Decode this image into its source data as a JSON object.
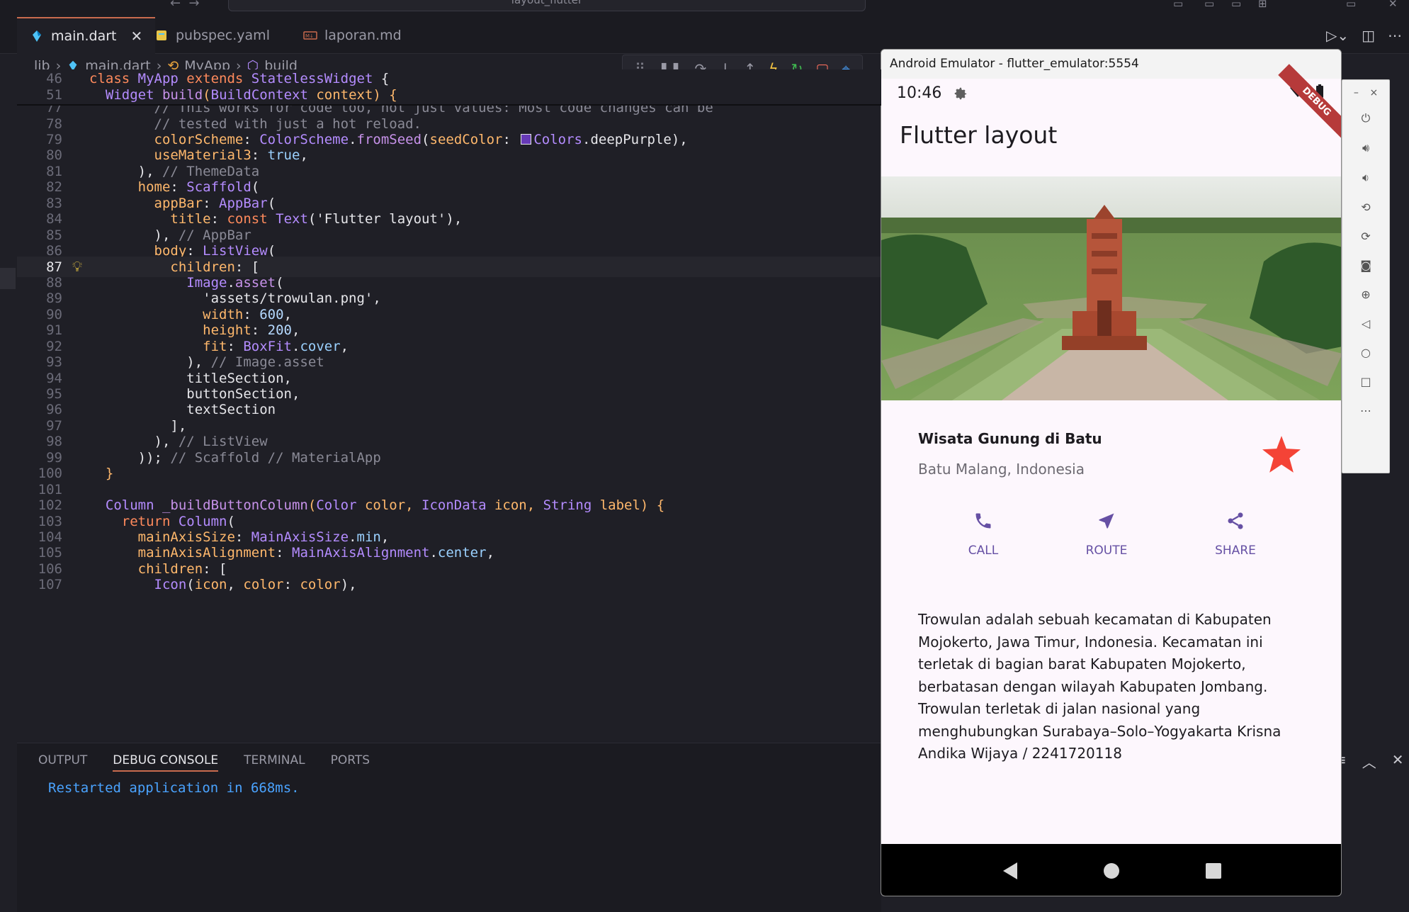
{
  "window": {
    "command_center": "layout_flutter"
  },
  "tabs": [
    {
      "label": "main.dart",
      "active": true
    },
    {
      "label": "pubspec.yaml",
      "active": false
    },
    {
      "label": "laporan.md",
      "active": false
    }
  ],
  "breadcrumb": [
    "lib",
    "main.dart",
    "MyApp",
    "build"
  ],
  "editor": {
    "sticky": [
      {
        "ln": "46",
        "tokens": [
          [
            "kw",
            "class "
          ],
          [
            "ty",
            "MyApp "
          ],
          [
            "kw",
            "extends "
          ],
          [
            "ty",
            "StatelessWidget "
          ],
          [
            "pl",
            "{"
          ]
        ]
      },
      {
        "ln": "51",
        "tokens": [
          [
            "pl",
            "  "
          ],
          [
            "ty",
            "Widget "
          ],
          [
            "fn",
            "build"
          ],
          [
            "prop",
            "("
          ],
          [
            "ty",
            "BuildContext "
          ],
          [
            "prop",
            "context"
          ],
          [
            "prop",
            ") {"
          ]
        ]
      }
    ],
    "lines": [
      {
        "ln": "77",
        "tokens": [
          [
            "cm",
            "        // This works for code too, not just values: Most code changes can be"
          ]
        ]
      },
      {
        "ln": "78",
        "tokens": [
          [
            "cm",
            "        // tested with just a hot reload."
          ]
        ]
      },
      {
        "ln": "79",
        "tokens": [
          [
            "prop",
            "        colorScheme"
          ],
          [
            "pl",
            ": "
          ],
          [
            "ty",
            "ColorScheme"
          ],
          [
            "pl",
            "."
          ],
          [
            "fn",
            "fromSeed"
          ],
          [
            "pl",
            "("
          ],
          [
            "prop",
            "seedColor"
          ],
          [
            "pl",
            ": "
          ],
          [
            "sw",
            ""
          ],
          [
            "ty",
            "Colors"
          ],
          [
            "pl",
            "."
          ],
          [
            "pl",
            "deepPurple"
          ],
          [
            "pl",
            "),"
          ]
        ]
      },
      {
        "ln": "80",
        "tokens": [
          [
            "prop",
            "        useMaterial3"
          ],
          [
            "pl",
            ": "
          ],
          [
            "lit",
            "true"
          ],
          [
            "pl",
            ","
          ]
        ]
      },
      {
        "ln": "81",
        "tokens": [
          [
            "pl",
            "      ), "
          ],
          [
            "cm",
            "// ThemeData"
          ]
        ]
      },
      {
        "ln": "82",
        "tokens": [
          [
            "prop",
            "      home"
          ],
          [
            "pl",
            ": "
          ],
          [
            "ty",
            "Scaffold"
          ],
          [
            "pl",
            "("
          ]
        ]
      },
      {
        "ln": "83",
        "tokens": [
          [
            "prop",
            "        appBar"
          ],
          [
            "pl",
            ": "
          ],
          [
            "ty",
            "AppBar"
          ],
          [
            "pl",
            "("
          ]
        ]
      },
      {
        "ln": "84",
        "tokens": [
          [
            "prop",
            "          title"
          ],
          [
            "pl",
            ": "
          ],
          [
            "kw",
            "const "
          ],
          [
            "ty",
            "Text"
          ],
          [
            "pl",
            "("
          ],
          [
            "str",
            "'Flutter layout'"
          ],
          [
            "pl",
            "),"
          ]
        ]
      },
      {
        "ln": "85",
        "tokens": [
          [
            "pl",
            "        ), "
          ],
          [
            "cm",
            "// AppBar"
          ]
        ]
      },
      {
        "ln": "86",
        "tokens": [
          [
            "prop",
            "        body"
          ],
          [
            "pl",
            ": "
          ],
          [
            "ty",
            "ListView"
          ],
          [
            "pl",
            "("
          ]
        ]
      },
      {
        "ln": "87",
        "tokens": [
          [
            "prop",
            "          children"
          ],
          [
            "pl",
            ": ["
          ]
        ]
      },
      {
        "ln": "88",
        "tokens": [
          [
            "ty",
            "            Image"
          ],
          [
            "pl",
            "."
          ],
          [
            "fn",
            "asset"
          ],
          [
            "pl",
            "("
          ]
        ]
      },
      {
        "ln": "89",
        "tokens": [
          [
            "str",
            "              'assets/trowulan.png'"
          ],
          [
            "pl",
            ","
          ]
        ]
      },
      {
        "ln": "90",
        "tokens": [
          [
            "prop",
            "              width"
          ],
          [
            "pl",
            ": "
          ],
          [
            "num",
            "600"
          ],
          [
            "pl",
            ","
          ]
        ]
      },
      {
        "ln": "91",
        "tokens": [
          [
            "prop",
            "              height"
          ],
          [
            "pl",
            ": "
          ],
          [
            "num",
            "200"
          ],
          [
            "pl",
            ","
          ]
        ]
      },
      {
        "ln": "92",
        "tokens": [
          [
            "prop",
            "              fit"
          ],
          [
            "pl",
            ": "
          ],
          [
            "ty",
            "BoxFit"
          ],
          [
            "pl",
            "."
          ],
          [
            "lit",
            "cover"
          ],
          [
            "pl",
            ","
          ]
        ]
      },
      {
        "ln": "93",
        "tokens": [
          [
            "pl",
            "            ), "
          ],
          [
            "cm",
            "// Image.asset"
          ]
        ]
      },
      {
        "ln": "94",
        "tokens": [
          [
            "pl",
            "            titleSection,"
          ]
        ]
      },
      {
        "ln": "95",
        "tokens": [
          [
            "pl",
            "            buttonSection,"
          ]
        ]
      },
      {
        "ln": "96",
        "tokens": [
          [
            "pl",
            "            textSection"
          ]
        ]
      },
      {
        "ln": "97",
        "tokens": [
          [
            "pl",
            "          ],"
          ]
        ]
      },
      {
        "ln": "98",
        "tokens": [
          [
            "pl",
            "        ), "
          ],
          [
            "cm",
            "// ListView"
          ]
        ]
      },
      {
        "ln": "99",
        "tokens": [
          [
            "pl",
            "      )); "
          ],
          [
            "cm",
            "// Scaffold // MaterialApp"
          ]
        ]
      },
      {
        "ln": "100",
        "tokens": [
          [
            "prop",
            "  }"
          ]
        ]
      },
      {
        "ln": "101",
        "tokens": [
          [
            "pl",
            ""
          ]
        ]
      },
      {
        "ln": "102",
        "tokens": [
          [
            "ty",
            "  Column "
          ],
          [
            "fn",
            "_buildButtonColumn"
          ],
          [
            "prop",
            "("
          ],
          [
            "ty",
            "Color "
          ],
          [
            "prop",
            "color, "
          ],
          [
            "ty",
            "IconData "
          ],
          [
            "prop",
            "icon, "
          ],
          [
            "ty",
            "String "
          ],
          [
            "prop",
            "label) {"
          ]
        ]
      },
      {
        "ln": "103",
        "tokens": [
          [
            "kw",
            "    return "
          ],
          [
            "ty",
            "Column"
          ],
          [
            "pl",
            "("
          ]
        ]
      },
      {
        "ln": "104",
        "tokens": [
          [
            "prop",
            "      mainAxisSize"
          ],
          [
            "pl",
            ": "
          ],
          [
            "ty",
            "MainAxisSize"
          ],
          [
            "pl",
            "."
          ],
          [
            "lit",
            "min"
          ],
          [
            "pl",
            ","
          ]
        ]
      },
      {
        "ln": "105",
        "tokens": [
          [
            "prop",
            "      mainAxisAlignment"
          ],
          [
            "pl",
            ": "
          ],
          [
            "ty",
            "MainAxisAlignment"
          ],
          [
            "pl",
            "."
          ],
          [
            "lit",
            "center"
          ],
          [
            "pl",
            ","
          ]
        ]
      },
      {
        "ln": "106",
        "tokens": [
          [
            "prop",
            "      children"
          ],
          [
            "pl",
            ": ["
          ]
        ]
      },
      {
        "ln": "107",
        "tokens": [
          [
            "ty",
            "        Icon"
          ],
          [
            "pl",
            "("
          ],
          [
            "prop",
            "icon"
          ],
          [
            "pl",
            ", "
          ],
          [
            "prop",
            "color"
          ],
          [
            "pl",
            ": "
          ],
          [
            "prop",
            "color"
          ],
          [
            "pl",
            "),"
          ]
        ]
      }
    ],
    "current_line": "87"
  },
  "panel": {
    "tabs": [
      "OUTPUT",
      "DEBUG CONSOLE",
      "TERMINAL",
      "PORTS"
    ],
    "active_tab": "DEBUG CONSOLE",
    "console_text": "Restarted application in 668ms."
  },
  "emulator": {
    "title": "Android Emulator - flutter_emulator:5554",
    "time": "10:46",
    "debug_banner": "DEBUG",
    "app_title": "Flutter layout",
    "title_section": {
      "title": "Wisata Gunung di Batu",
      "subtitle": "Batu Malang, Indonesia"
    },
    "buttons": [
      {
        "label": "CALL",
        "icon": "phone-icon"
      },
      {
        "label": "ROUTE",
        "icon": "near-me-icon"
      },
      {
        "label": "SHARE",
        "icon": "share-icon"
      }
    ],
    "body_text": "Trowulan adalah sebuah kecamatan di Kabupaten Mojokerto, Jawa Timur, Indonesia. Kecamatan ini terletak di bagian barat Kabupaten Mojokerto, berbatasan dengan wilayah Kabupaten Jombang. Trowulan terletak di jalan nasional yang menghubungkan Surabaya–Solo–Yogyakarta Krisna Andika Wijaya / 2241720118",
    "colors": {
      "accent": "#6650a4",
      "star": "#f44336",
      "background": "#fdf7fd"
    }
  }
}
